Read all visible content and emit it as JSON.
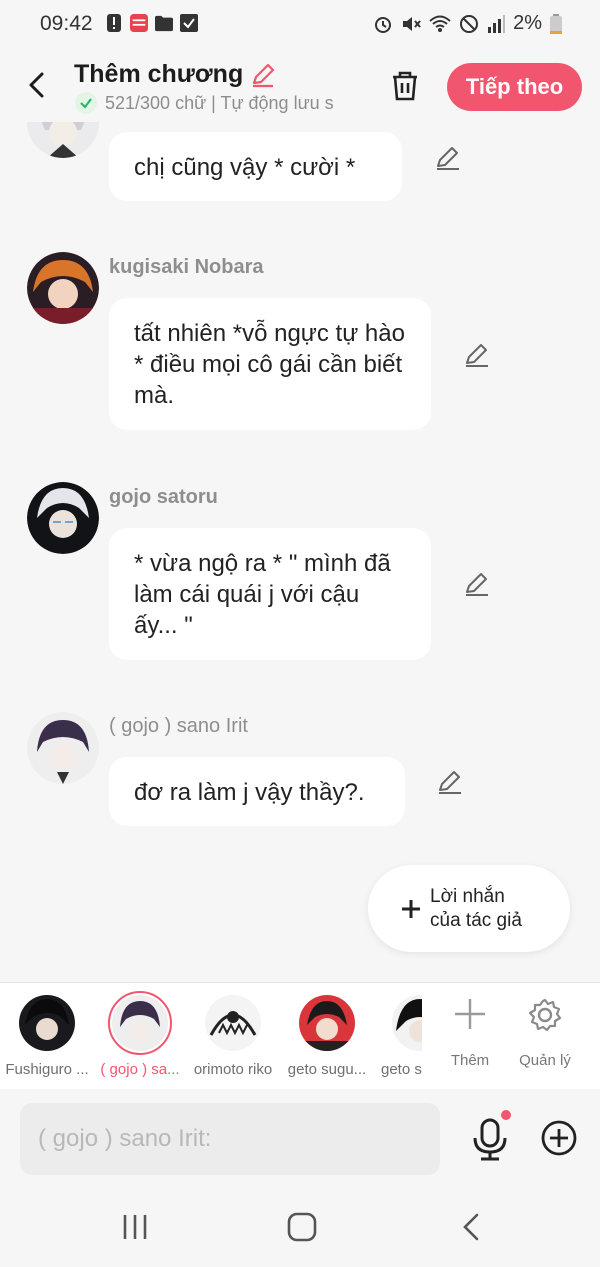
{
  "status": {
    "time": "09:42",
    "battery": "2%"
  },
  "header": {
    "title": "Thêm chương",
    "subtitle": "521/300 chữ | Tự động lưu s",
    "next_label": "Tiếp theo"
  },
  "messages": [
    {
      "name": "",
      "text": "chị cũng vậy * cười *"
    },
    {
      "name": "kugisaki Nobara",
      "text": "tất nhiên *vỗ ngực tự hào * điều mọi cô gái cần biết mà."
    },
    {
      "name": "gojo satoru",
      "text": "* vừa ngộ ra * \" mình đã làm cái quái j với cậu ấy... \""
    },
    {
      "name": "( gojo ) sano Irit",
      "text": "đơ ra làm j vậy thầy?."
    }
  ],
  "author_note_label": "Lời nhắn của tác giả",
  "characters": [
    {
      "name": "Fushiguro ...",
      "selected": false
    },
    {
      "name": "( gojo ) sa...",
      "selected": true
    },
    {
      "name": "orimoto riko",
      "selected": false
    },
    {
      "name": "geto sugu...",
      "selected": false
    },
    {
      "name": "geto s",
      "selected": false
    }
  ],
  "tools": {
    "add_label": "Thêm",
    "manage_label": "Quản lý"
  },
  "input": {
    "placeholder": "( gojo ) sano Irit:"
  },
  "colors": {
    "accent": "#f2566e",
    "background": "#f6f6f6",
    "bubble": "#ffffff"
  }
}
